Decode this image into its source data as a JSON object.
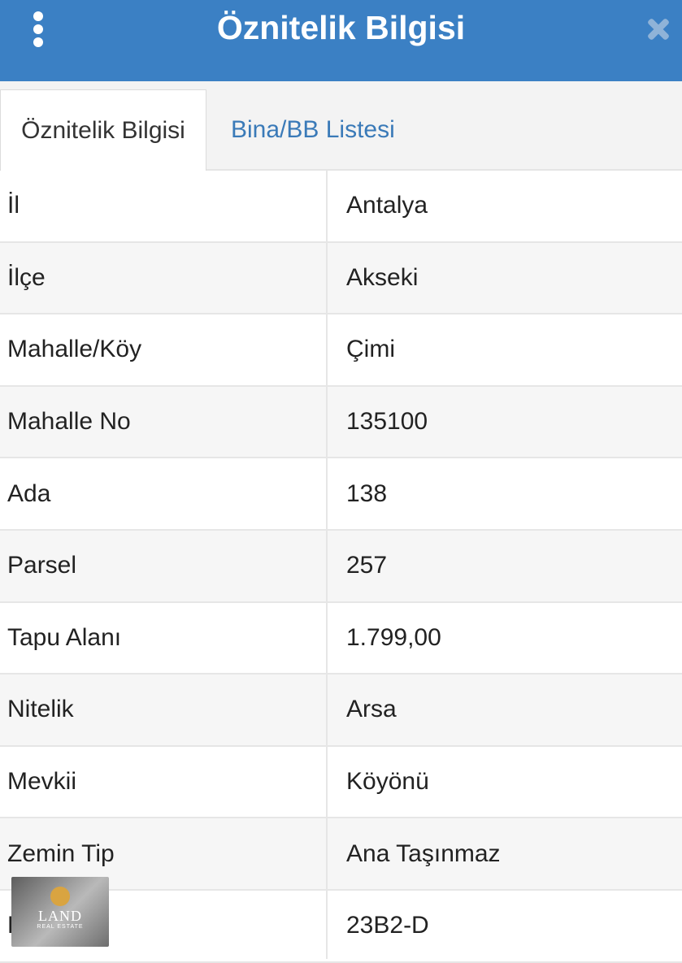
{
  "header": {
    "title": "Öznitelik Bilgisi"
  },
  "tabs": [
    {
      "label": "Öznitelik Bilgisi",
      "active": true
    },
    {
      "label": "Bina/BB Listesi",
      "active": false
    }
  ],
  "rows": [
    {
      "key": "İl",
      "value": "Antalya"
    },
    {
      "key": "İlçe",
      "value": "Akseki"
    },
    {
      "key": "Mahalle/Köy",
      "value": "Çimi"
    },
    {
      "key": "Mahalle No",
      "value": "135100"
    },
    {
      "key": "Ada",
      "value": "138"
    },
    {
      "key": "Parsel",
      "value": "257"
    },
    {
      "key": "Tapu Alanı",
      "value": "1.799,00"
    },
    {
      "key": "Nitelik",
      "value": "Arsa"
    },
    {
      "key": "Mevkii",
      "value": "Köyönü"
    },
    {
      "key": "Zemin Tip",
      "value": "Ana Taşınmaz"
    },
    {
      "key": "Pafta",
      "value": "23B2-D"
    }
  ],
  "logo": {
    "text": "LAND",
    "subtext": "REAL ESTATE"
  },
  "colors": {
    "header": "#3b80c4",
    "tab_link": "#3a7ab8"
  },
  "icons": {
    "menu": "vertical-dots-icon",
    "close": "close-icon"
  }
}
